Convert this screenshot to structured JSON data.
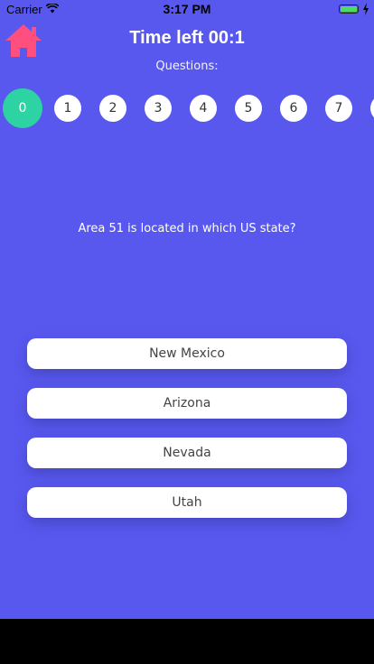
{
  "status_bar": {
    "carrier": "Carrier",
    "time": "3:17 PM"
  },
  "header": {
    "title": "Time left 00:1",
    "subtitle": "Questions:"
  },
  "pager": {
    "items": [
      "0",
      "1",
      "2",
      "3",
      "4",
      "5",
      "6",
      "7",
      ""
    ],
    "active_index": 0
  },
  "question": {
    "text": "Area 51 is located in which US state?"
  },
  "answers": [
    "New Mexico",
    "Arizona",
    "Nevada",
    "Utah"
  ],
  "colors": {
    "background": "#5858EF",
    "active": "#2ED3A3",
    "home_icon": "#FF4F7E"
  }
}
